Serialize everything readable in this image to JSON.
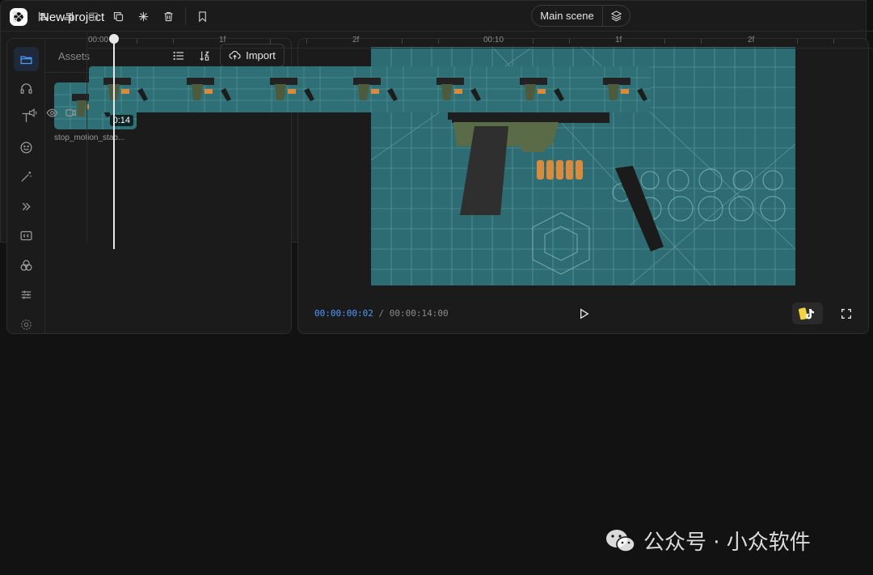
{
  "app": {
    "project_title": "New project"
  },
  "assets": {
    "header_label": "Assets",
    "import_label": "Import",
    "items": [
      {
        "name": "stop_motion_stab...",
        "duration": "0:14"
      }
    ]
  },
  "preview": {
    "current_time": "00:00:00:02",
    "separator": "/",
    "total_time": "00:00:14:00"
  },
  "timeline": {
    "scene_label": "Main scene",
    "ruler_labels": [
      "00:00",
      "1f",
      "2f",
      "00:10",
      "1f",
      "2f"
    ]
  },
  "watermark": {
    "text": "公众号 · 小众软件"
  },
  "colors": {
    "accent": "#4c9bff",
    "background": "#121212",
    "panel": "#1b1b1b"
  }
}
